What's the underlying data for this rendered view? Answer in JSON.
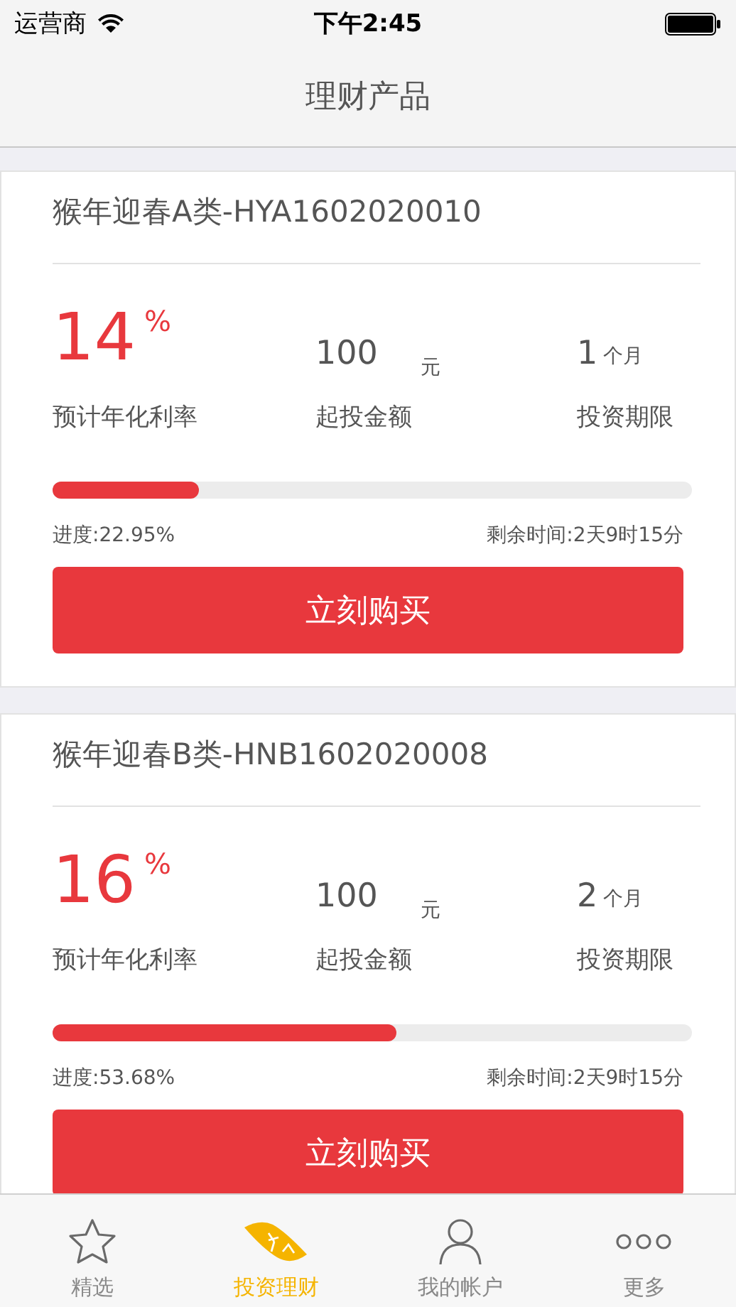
{
  "status_bar": {
    "carrier": "运营商",
    "time": "下午2:45"
  },
  "nav": {
    "title": "理财产品"
  },
  "products": [
    {
      "title": "猴年迎春A类-HYA1602020010",
      "rate": "14",
      "rate_unit": "%",
      "rate_label": "预计年化利率",
      "amount": "100",
      "amount_unit": "元",
      "amount_label": "起投金额",
      "term": "1",
      "term_unit": "个月",
      "term_label": "投资期限",
      "level": 0.2295,
      "progress_text": "进度:22.95%",
      "remaining_text": "剩余时间:2天9时15分",
      "button": "立刻购买"
    },
    {
      "title": "猴年迎春B类-HNB1602020008",
      "rate": "16",
      "rate_unit": "%",
      "rate_label": "预计年化利率",
      "amount": "100",
      "amount_unit": "元",
      "amount_label": "起投金额",
      "term": "2",
      "term_unit": "个月",
      "term_label": "投资期限",
      "level": 0.5368,
      "progress_text": "进度:53.68%",
      "remaining_text": "剩余时间:2天9时15分",
      "button": "立刻购买"
    }
  ],
  "tabs": [
    {
      "kind": "star",
      "label": "精选",
      "selected": false
    },
    {
      "kind": "money",
      "label": "投资理财",
      "selected": true
    },
    {
      "kind": "person",
      "label": "我的帐户",
      "selected": false
    },
    {
      "kind": "more",
      "label": "更多",
      "selected": false
    }
  ]
}
